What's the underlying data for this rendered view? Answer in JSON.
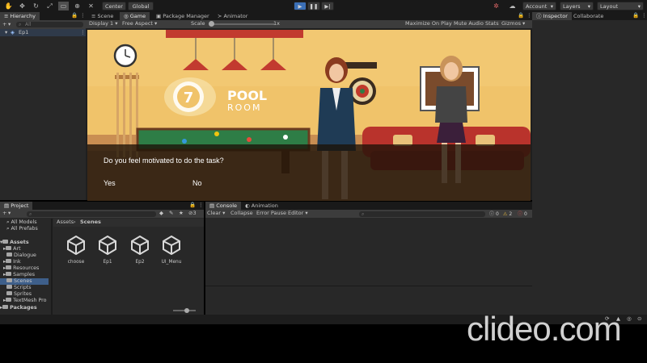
{
  "toolbar": {
    "tools": [
      "hand-tool",
      "move-tool",
      "rotate-tool",
      "scale-tool",
      "rect-tool",
      "transform-tool",
      "custom-tool"
    ],
    "pivot_label": "Center",
    "space_label": "Global",
    "account_label": "Account",
    "layers_label": "Layers",
    "layout_label": "Layout"
  },
  "hierarchy": {
    "tab": "Hierarchy",
    "search_placeholder": "All",
    "add_label": "+",
    "root": "Ep1"
  },
  "scene_view": {
    "tabs": [
      "Scene",
      "Game",
      "Package Manager",
      "Animator"
    ],
    "display": "Display 1",
    "aspect": "Free Aspect",
    "scale_label": "Scale",
    "scale_value": "1x",
    "right_options": [
      "Maximize On Play",
      "Mute Audio",
      "Stats",
      "Gizmos"
    ]
  },
  "game": {
    "poster_number": "7",
    "poster_line1": "POOL",
    "poster_line2": "ROOM",
    "question": "Do you feel motivated to do the task?",
    "choice_yes": "Yes",
    "choice_no": "No",
    "colors": {
      "wall": "#f0c36a",
      "floor": "#a8754a",
      "table": "#2e7d46",
      "sofa": "#b9332c"
    }
  },
  "inspector": {
    "tabs": [
      "Inspector",
      "Collaborate"
    ]
  },
  "project": {
    "tab": "Project",
    "add_label": "+",
    "favorites": [
      "All Models",
      "All Prefabs"
    ],
    "assets_label": "Assets",
    "folders": [
      "Art",
      "Dialogue",
      "Ink",
      "Resources",
      "Samples",
      "Scenes",
      "Scripts",
      "Sprites",
      "TextMesh Pro"
    ],
    "packages_label": "Packages",
    "breadcrumb": [
      "Assets",
      "Scenes"
    ],
    "hidden_count": "3",
    "assets": [
      "choose",
      "Ep1",
      "Ep2",
      "UI_Menu"
    ]
  },
  "console": {
    "tabs": [
      "Console",
      "Animation"
    ],
    "buttons": [
      "Clear",
      "Collapse",
      "Error Pause",
      "Editor"
    ],
    "counts": {
      "info": "0",
      "warning": "2",
      "error": "0"
    }
  },
  "watermark": "clideo.com"
}
